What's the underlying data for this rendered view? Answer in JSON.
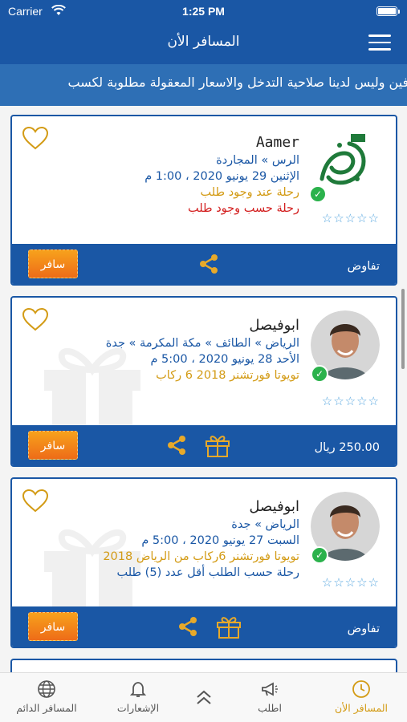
{
  "status_bar": {
    "carrier": "Carrier",
    "time": "1:25 PM"
  },
  "navbar": {
    "title": "المسافر الأن"
  },
  "ticker": {
    "text": "بين الطرفين وليس لدينا صلاحية التدخل والاسعار المعقولة مطلوبة لكسب"
  },
  "cards": [
    {
      "name": "Aamer",
      "route": "الرس » المجاردة",
      "date": "الإثنين 29 يونيو 2020 ، 1:00 م",
      "line3": "رحلة عند وجود طلب",
      "line4": "رحلة حسب وجود طلب",
      "bar_text": "تفاوض",
      "button": "سافر",
      "avatar_logo_text": "عاشق وطن"
    },
    {
      "name": "ابوفيصل",
      "route": "الرياض » الطائف » مكة المكرمة » جدة",
      "date": "الأحد 28 يونيو 2020 ، 5:00 م",
      "line3": "تويوتا فورتشنر 2018 6 ركاب",
      "bar_text": "250.00 ريال",
      "button": "سافر"
    },
    {
      "name": "ابوفيصل",
      "route": "الرياض » جدة",
      "date": "السبت 27 يونيو 2020 ، 5:00 م",
      "line3": "تويوتا فورتشنر 6ركاب من الرياض 2018",
      "line4": "رحلة حسب الطلب أقل عدد (5) طلب",
      "bar_text": "تفاوض",
      "button": "سافر"
    }
  ],
  "tabbar": {
    "items": [
      {
        "label": "المسافر الأن",
        "icon": "clock-icon",
        "active": true
      },
      {
        "label": "اطلب",
        "icon": "megaphone-icon"
      },
      {
        "label": "",
        "icon": "double-chevron-up-icon"
      },
      {
        "label": "الإشعارات",
        "icon": "bell-icon"
      },
      {
        "label": "المسافر الدائم",
        "icon": "globe-icon"
      }
    ]
  },
  "colors": {
    "primary": "#1a57a5",
    "accent": "#d39b15",
    "button": "#f28a1a",
    "red": "#d31f1f"
  },
  "ratings": [
    0,
    0,
    0
  ]
}
